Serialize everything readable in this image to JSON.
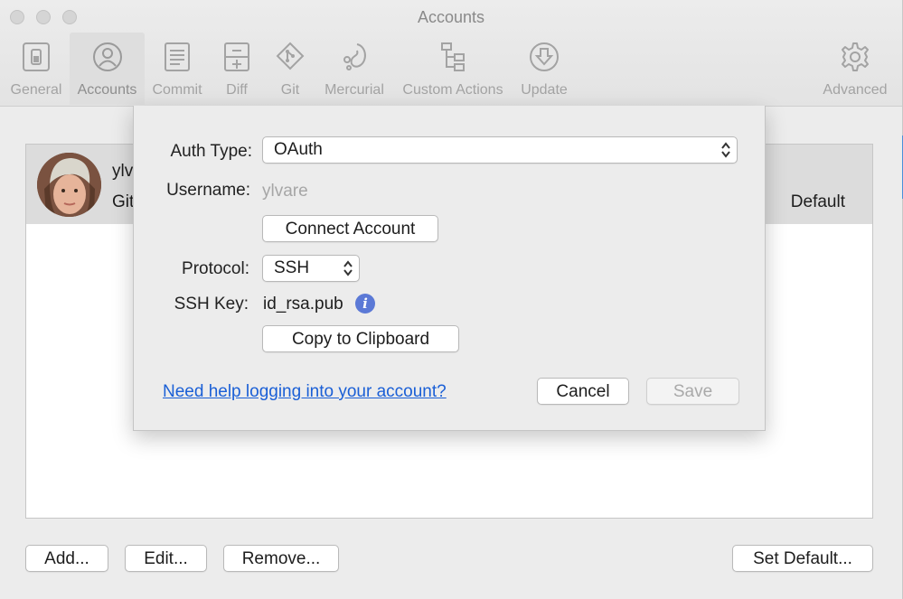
{
  "window": {
    "title": "Accounts"
  },
  "toolbar": {
    "items": [
      {
        "label": "General",
        "icon": "switch-icon"
      },
      {
        "label": "Accounts",
        "icon": "user-icon"
      },
      {
        "label": "Commit",
        "icon": "document-icon"
      },
      {
        "label": "Diff",
        "icon": "diff-icon"
      },
      {
        "label": "Git",
        "icon": "git-icon"
      },
      {
        "label": "Mercurial",
        "icon": "mercurial-icon"
      },
      {
        "label": "Custom Actions",
        "icon": "custom-actions-icon"
      },
      {
        "label": "Update",
        "icon": "download-icon"
      },
      {
        "label": "Advanced",
        "icon": "gear-icon"
      }
    ],
    "active": "Accounts"
  },
  "accounts_list": {
    "row": {
      "name": "ylv",
      "host": "Git",
      "status": "Default"
    }
  },
  "sheet": {
    "auth_type_label": "Auth Type:",
    "auth_type_value": "OAuth",
    "username_label": "Username:",
    "username_placeholder": "ylvare",
    "connect_button": "Connect Account",
    "protocol_label": "Protocol:",
    "protocol_value": "SSH",
    "ssh_key_label": "SSH Key:",
    "ssh_key_value": "id_rsa.pub",
    "info_glyph": "i",
    "copy_button": "Copy to Clipboard",
    "help_link": "Need help logging into your account?",
    "cancel_button": "Cancel",
    "save_button": "Save"
  },
  "bottom_buttons": {
    "add": "Add...",
    "edit": "Edit...",
    "remove": "Remove...",
    "set_default": "Set Default..."
  },
  "colors": {
    "link": "#1a5fd6",
    "info_icon": "#5b79d6",
    "window_bg": "#ececec",
    "selected_row": "#dcdcdc"
  }
}
